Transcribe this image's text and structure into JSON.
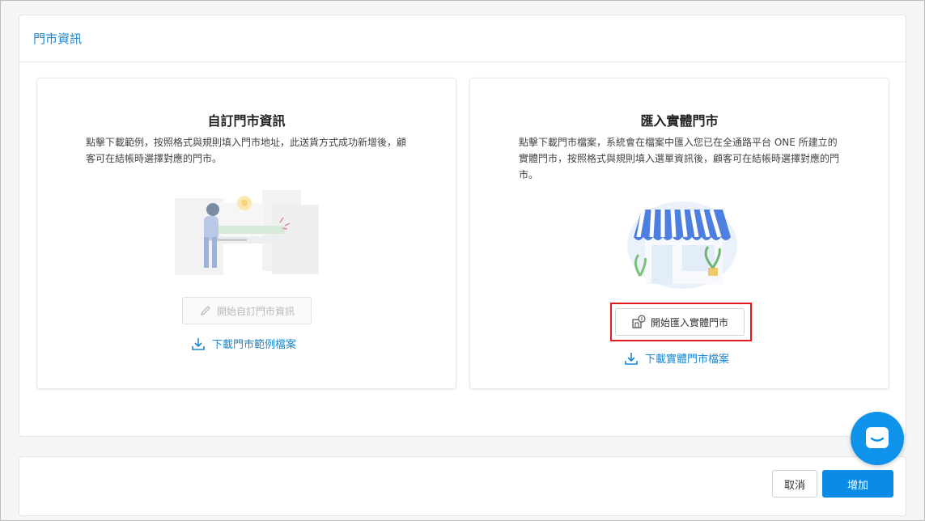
{
  "panel": {
    "title": "門市資訊"
  },
  "custom_card": {
    "title": "自訂門市資訊",
    "description": "點擊下載範例，按照格式與規則填入門市地址，此送貨方式成功新增後，顧客可在結帳時選擇對應的門市。",
    "start_button": "開始自訂門市資訊",
    "download_link": "下載門市範例檔案"
  },
  "import_card": {
    "title": "匯入實體門市",
    "description": "點擊下載門市檔案，系統會在檔案中匯入您已在全通路平台 ONE 所建立的實體門市，按照格式與規則填入選單資訊後，顧客可在結帳時選擇對應的門市。",
    "start_button": "開始匯入實體門市",
    "download_link": "下載實體門市檔案"
  },
  "footer": {
    "cancel_label": "取消",
    "add_label": "增加"
  },
  "icons": {
    "pencil": "pencil-icon",
    "download": "download-icon",
    "store": "store-icon",
    "chat": "chat-icon"
  },
  "colors": {
    "accent": "#1a87d0",
    "primary_button": "#0a8ce6",
    "highlight": "#e11b1b"
  }
}
